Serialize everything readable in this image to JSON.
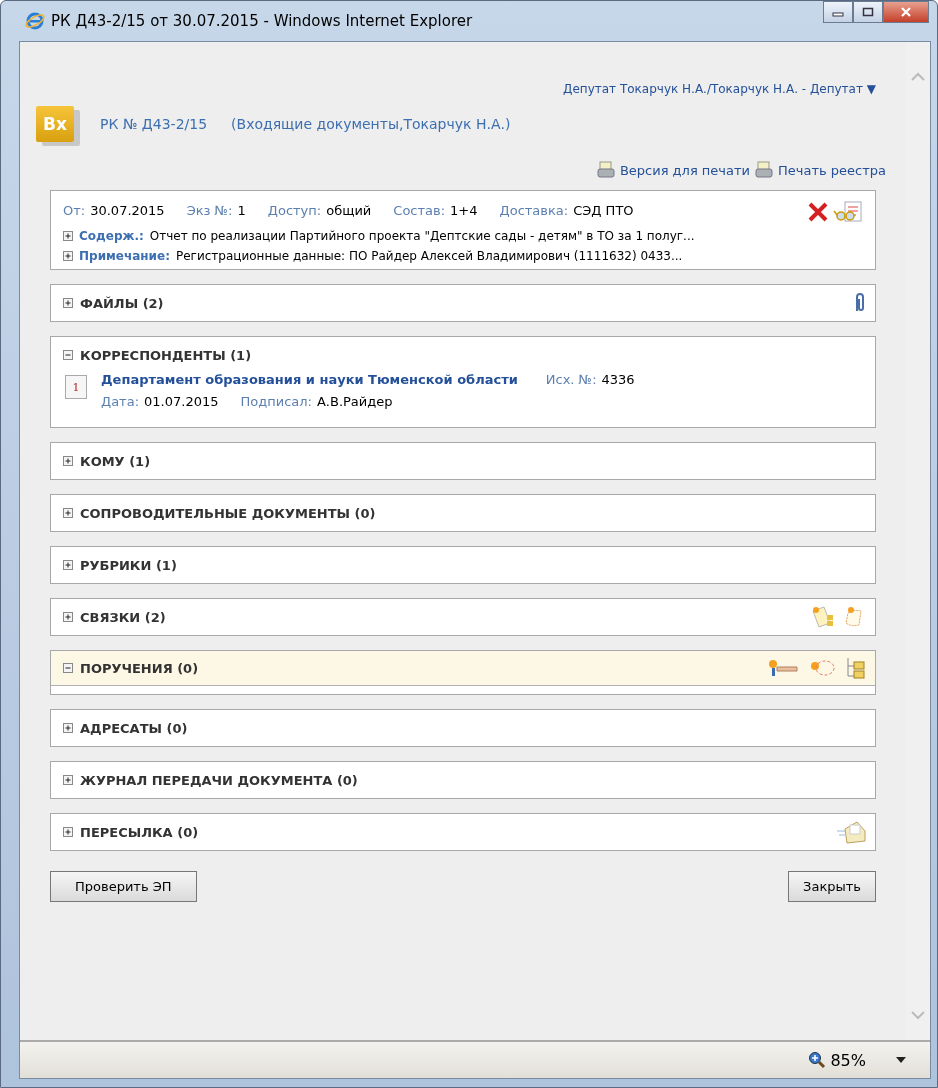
{
  "window": {
    "title": "РК Д43-2/15 от 30.07.2015 - Windows Internet Explorer"
  },
  "user_menu": {
    "label": "Депутат Токарчук Н.А./Токарчук Н.А. - Депутат",
    "caret": "▼"
  },
  "header": {
    "badge": "Вх",
    "number": "РК № Д43-2/15",
    "context": "(Входящие документы,Токарчук Н.А.)"
  },
  "print_links": [
    "Версия для печати",
    "Печать реестра"
  ],
  "info": {
    "fields": [
      {
        "label": "От:",
        "value": "30.07.2015"
      },
      {
        "label": "Экз №:",
        "value": "1"
      },
      {
        "label": "Доступ:",
        "value": "общий"
      },
      {
        "label": "Состав:",
        "value": "1+4"
      },
      {
        "label": "Доставка:",
        "value": "СЭД ПТО"
      }
    ],
    "details": [
      {
        "label": "Содерж.:",
        "value": "Отчет по реализации Партийного проекта \"Дептские сады - детям\" в ТО за 1 полуг...",
        "expanded": false
      },
      {
        "label": "Примечание:",
        "value": "Регистрационные данные: ПО Райдер Алексей Владимирович (1111632) 0433...",
        "expanded": false
      }
    ]
  },
  "sections": [
    {
      "title": "ФАЙЛЫ (2)",
      "expanded": false,
      "highlighted": false
    },
    {
      "title": "КОРРЕСПОНДЕНТЫ (1)",
      "expanded": true,
      "highlighted": false,
      "correspondents": [
        {
          "index": "1",
          "name": "Департамент образования и науки Тюменской области",
          "out_label": "Исх. №:",
          "out_number": "4336",
          "date_label": "Дата:",
          "date": "01.07.2015",
          "signed_label": "Подписал:",
          "signed": "А.В.Райдер"
        }
      ]
    },
    {
      "title": "КОМУ (1)",
      "expanded": false,
      "highlighted": false
    },
    {
      "title": "СОПРОВОДИТЕЛЬНЫЕ ДОКУМЕНТЫ (0)",
      "expanded": false,
      "highlighted": false
    },
    {
      "title": "РУБРИКИ (1)",
      "expanded": false,
      "highlighted": false
    },
    {
      "title": "СВЯЗКИ (2)",
      "expanded": false,
      "highlighted": false
    },
    {
      "title": "ПОРУЧЕНИЯ (0)",
      "expanded": true,
      "highlighted": true
    },
    {
      "title": "АДРЕСАТЫ (0)",
      "expanded": false,
      "highlighted": false
    },
    {
      "title": "ЖУРНАЛ ПЕРЕДАЧИ ДОКУМЕНТА (0)",
      "expanded": false,
      "highlighted": false
    },
    {
      "title": "ПЕРЕСЫЛКА (0)",
      "expanded": false,
      "highlighted": false
    }
  ],
  "buttons": [
    "Проверить ЭП",
    "Закрыть"
  ],
  "status_bar": {
    "zoom": "85%"
  }
}
